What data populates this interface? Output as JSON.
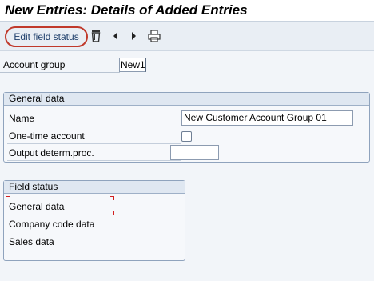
{
  "window": {
    "title": "New Entries: Details of Added Entries"
  },
  "toolbar": {
    "edit_field_status_label": "Edit field status",
    "icons": [
      "trash-icon",
      "triangle-left-icon",
      "triangle-right-icon",
      "printer-icon"
    ]
  },
  "account_group": {
    "label": "Account group",
    "value": "New1"
  },
  "general_data": {
    "title": "General data",
    "name": {
      "label": "Name",
      "value": "New Customer Account Group 01"
    },
    "one_time_account": {
      "label": "One-time account",
      "checked": false
    },
    "output_determ": {
      "label": "Output determ.proc.",
      "value": ""
    }
  },
  "field_status": {
    "title": "Field status",
    "items": [
      "General data",
      "Company code data",
      "Sales data"
    ]
  },
  "colors": {
    "highlight_ring": "#c0392b",
    "focus_corner": "#d22020",
    "link_text": "#1f3f6b"
  }
}
